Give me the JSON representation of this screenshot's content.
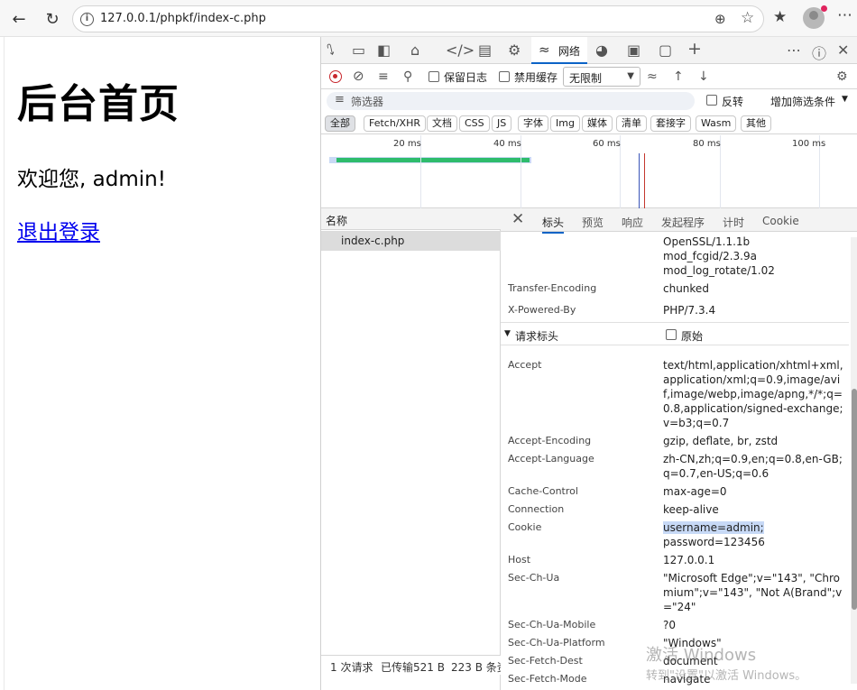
{
  "browser": {
    "url": "127.0.0.1/phpkf/index-c.php"
  },
  "page": {
    "title": "后台首页",
    "welcome": "欢迎您, admin!",
    "logout": "退出登录"
  },
  "devtools": {
    "network_tab_label": "网络",
    "toolbar": {
      "preserve_log": "保留日志",
      "disable_cache": "禁用缓存",
      "throttle": "无限制"
    },
    "filter": {
      "placeholder": "筛选器",
      "invert": "反转",
      "more_filters": "增加筛选条件"
    },
    "types": [
      "全部",
      "Fetch/XHR",
      "文档",
      "CSS",
      "JS",
      "字体",
      "Img",
      "媒体",
      "清单",
      "套接字",
      "Wasm",
      "其他"
    ],
    "overview_ticks": [
      "20 ms",
      "40 ms",
      "60 ms",
      "80 ms",
      "100 ms"
    ],
    "requests": {
      "column_name": "名称",
      "rows": [
        "index-c.php"
      ],
      "status": {
        "count": "1 次请求",
        "transferred": "已传输521 B",
        "resources": "223 B 条资"
      }
    },
    "detail_tabs": [
      "标头",
      "预览",
      "响应",
      "发起程序",
      "计时",
      "Cookie"
    ],
    "response_headers_tail": [
      {
        "value": "OpenSSL/1.1.1b\nmod_fcgid/2.3.9a\nmod_log_rotate/1.02"
      },
      {
        "name": "Transfer-Encoding",
        "value": "chunked"
      },
      {
        "name": "X-Powered-By",
        "value": "PHP/7.3.4"
      }
    ],
    "request_headers_section": {
      "title": "请求标头",
      "raw": "原始"
    },
    "request_headers": [
      {
        "name": "Accept",
        "value": "text/html,application/xhtml+xml,application/xml;q=0.9,image/avif,image/webp,image/apng,*/*;q=0.8,application/signed-exchange;v=b3;q=0.7"
      },
      {
        "name": "Accept-Encoding",
        "value": "gzip, deflate, br, zstd"
      },
      {
        "name": "Accept-Language",
        "value": "zh-CN,zh;q=0.9,en;q=0.8,en-GB;q=0.7,en-US;q=0.6"
      },
      {
        "name": "Cache-Control",
        "value": "max-age=0"
      },
      {
        "name": "Connection",
        "value": "keep-alive"
      },
      {
        "name": "Cookie",
        "value_highlight": "username=admin;",
        "value_rest": "password=123456"
      },
      {
        "name": "Host",
        "value": "127.0.0.1"
      },
      {
        "name": "Sec-Ch-Ua",
        "value": "\"Microsoft Edge\";v=\"143\", \"Chromium\";v=\"143\", \"Not A(Brand\";v=\"24\""
      },
      {
        "name": "Sec-Ch-Ua-Mobile",
        "value": "?0"
      },
      {
        "name": "Sec-Ch-Ua-Platform",
        "value": "\"Windows\""
      },
      {
        "name": "Sec-Fetch-Dest",
        "value": "document"
      },
      {
        "name": "Sec-Fetch-Mode",
        "value": "navigate"
      }
    ]
  },
  "watermark": {
    "line1": "激活 Windows",
    "line2": "转到\"设置\"以激活 Windows。"
  }
}
